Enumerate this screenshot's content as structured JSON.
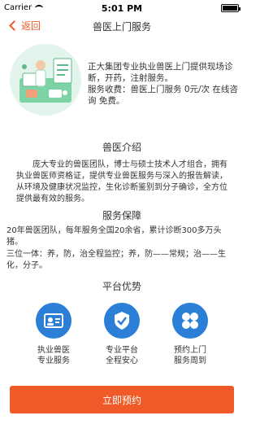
{
  "status_bar": {
    "carrier": "Carrier",
    "time": "5:01 PM"
  },
  "nav": {
    "back_label": "返回",
    "title": "兽医上门服务"
  },
  "hero": {
    "line1": "正大集团专业执业兽医上门提供现场诊断，开药，注射服务。",
    "line2": "服务收费：兽医上门服务 0元/次 在线咨询 免费。"
  },
  "intro": {
    "title": "兽医介绍",
    "body": "庞大专业的兽医团队，博士与硕士技术人才组合，拥有执业兽医师资格证，提供专业兽医服务与深入的报告解读，从环境及健康状况监控，生化诊断鉴别到分子确诊，全方位提供最有效的服务。"
  },
  "guarantee": {
    "title": "服务保障",
    "line1": "20年兽医团队，每年服务全国20余省，累计诊断300多万头猪。",
    "line2": "三位一体：养，防，治全程监控；养，防——常规；治——生化，分子。"
  },
  "advantages": {
    "title": "平台优势",
    "items": [
      {
        "label": "执业兽医专业服务",
        "icon": "id-card-icon"
      },
      {
        "label": "专业平台全程安心",
        "icon": "shield-check-icon"
      },
      {
        "label": "预约上门服务周到",
        "icon": "clover-icon"
      }
    ]
  },
  "cta": {
    "label": "立即预约"
  },
  "colors": {
    "accent": "#f05a28",
    "icon_blue": "#2b7fd6"
  }
}
